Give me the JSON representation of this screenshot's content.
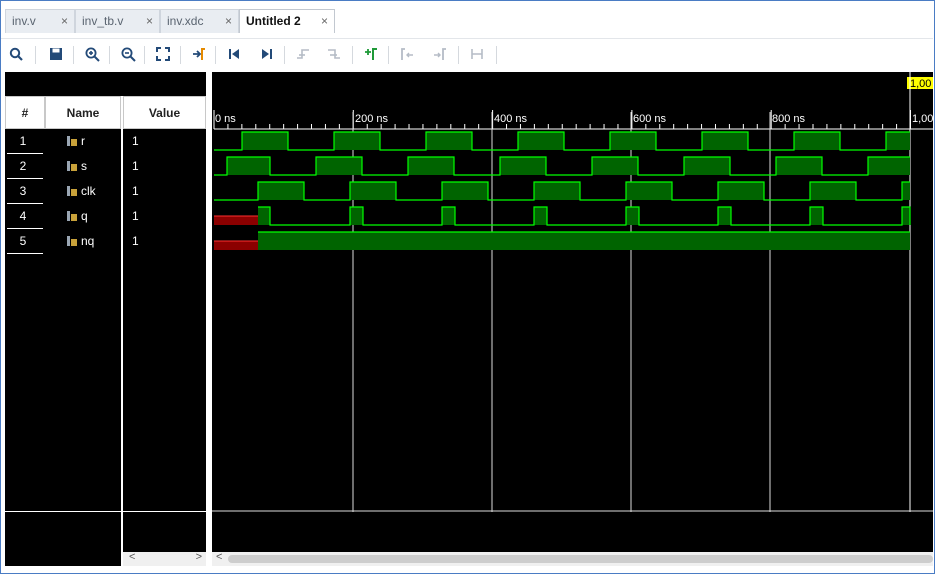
{
  "tabs": [
    {
      "label": "inv.v",
      "active": false,
      "close": "×"
    },
    {
      "label": "inv_tb.v",
      "active": false,
      "close": "×"
    },
    {
      "label": "inv.xdc",
      "active": false,
      "close": "×"
    },
    {
      "label": "Untitled 2",
      "active": true,
      "close": "×"
    }
  ],
  "toolbar": {
    "icons": [
      "search-icon",
      "save-icon",
      "zoom-in-icon",
      "zoom-out-icon",
      "zoom-fit-icon",
      "go-to-cursor-icon",
      "go-to-start-icon",
      "go-to-end-icon",
      "previous-transition-icon",
      "next-transition-icon",
      "add-marker-icon",
      "previous-marker-icon",
      "next-marker-icon",
      "swap-cursors-icon"
    ]
  },
  "table": {
    "col_num": "#",
    "col_name": "Name",
    "col_value": "Value"
  },
  "signals": [
    {
      "num": "1",
      "name": "r",
      "value": "1"
    },
    {
      "num": "2",
      "name": "s",
      "value": "1"
    },
    {
      "num": "3",
      "name": "clk",
      "value": "1"
    },
    {
      "num": "4",
      "name": "q",
      "value": "1"
    },
    {
      "num": "5",
      "name": "nq",
      "value": "1"
    }
  ],
  "timeline": {
    "ticks": [
      "0 ns",
      "200 ns",
      "400 ns",
      "600 ns",
      "800 ns",
      "1,00"
    ],
    "cursor_label": "1,00"
  },
  "scroll": {
    "left": "<",
    "right": ">"
  },
  "colors": {
    "wave_high": "#006400",
    "wave_line": "#00ff00",
    "undefined": "#8b0000",
    "background": "#000000"
  }
}
